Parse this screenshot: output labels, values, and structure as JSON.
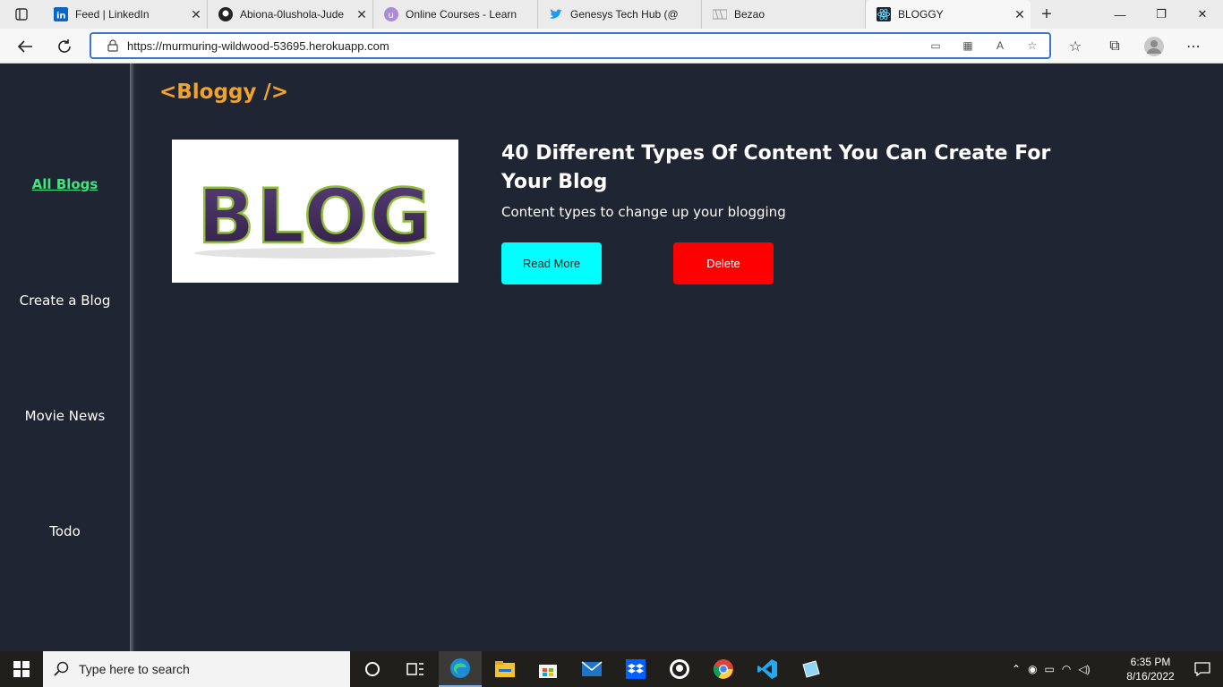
{
  "browser": {
    "tabs": [
      {
        "title": "Feed | LinkedIn",
        "icon": "linkedin-icon"
      },
      {
        "title": "Abiona-0lushola-Jude",
        "icon": "github-icon"
      },
      {
        "title": "Online Courses - Learn",
        "icon": "udemy-icon"
      },
      {
        "title": "Genesys Tech Hub (@",
        "icon": "twitter-icon"
      },
      {
        "title": "Bezao",
        "icon": "bezao-icon"
      },
      {
        "title": "BLOGGY",
        "icon": "react-icon"
      }
    ],
    "url": "https://murmuring-wildwood-53695.herokuapp.com"
  },
  "app": {
    "brand": "<Bloggy />",
    "nav": {
      "all_blogs": "All Blogs",
      "create_blog": "Create a Blog",
      "movie_news": "Movie News",
      "todo": "Todo"
    },
    "post": {
      "image_text": "BLOG",
      "title": "40 Different Types Of Content You Can Create For Your Blog",
      "subtitle": "Content types to change up your blogging",
      "read_more": "Read More",
      "delete": "Delete"
    },
    "colors": {
      "background": "#1f2532",
      "brand": "#f0a32a",
      "active_link": "#41e27f",
      "read_more": "#00ffff",
      "delete": "#ff0000"
    }
  },
  "taskbar": {
    "search_placeholder": "Type here to search",
    "time": "6:35 PM",
    "date": "8/16/2022"
  }
}
